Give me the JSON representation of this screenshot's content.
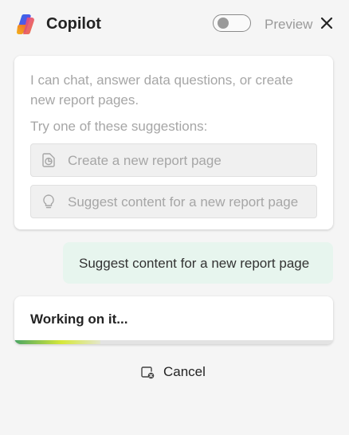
{
  "header": {
    "title": "Copilot",
    "preview_label": "Preview",
    "preview_toggle_on": false
  },
  "welcome_card": {
    "intro": "I can chat, answer data questions, or create new report pages.",
    "try_label": "Try one of these suggestions:",
    "suggestions": [
      {
        "label": "Create a new report page",
        "icon": "report-page-icon"
      },
      {
        "label": "Suggest content for a new report page",
        "icon": "lightbulb-icon"
      }
    ]
  },
  "user_message": {
    "text": "Suggest content for a new report page"
  },
  "status": {
    "text": "Working on it...",
    "progress_fraction": 0.27
  },
  "cancel": {
    "label": "Cancel",
    "icon": "cancel-stop-icon"
  },
  "colors": {
    "user_bubble": "#e7f5ee",
    "progress_start": "#4aa564",
    "progress_end": "#d6e83a"
  }
}
